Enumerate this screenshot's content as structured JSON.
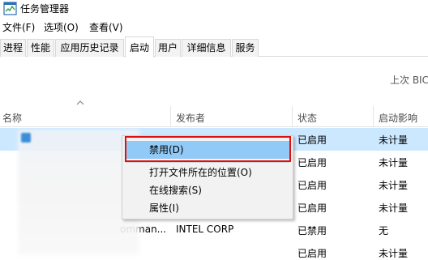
{
  "window": {
    "title": "任务管理器"
  },
  "menu": {
    "file": "文件(F)",
    "options": "选项(O)",
    "view": "查看(V)"
  },
  "tabs": [
    "进程",
    "性能",
    "应用历史记录",
    "启动",
    "用户",
    "详细信息",
    "服务"
  ],
  "active_tab": "启动",
  "top_right_text": "上次 BIC",
  "table": {
    "headers": {
      "name": "名称",
      "publisher": "发布者",
      "status": "状态",
      "impact": "启动影响"
    },
    "rows": [
      {
        "name": "",
        "publisher": "",
        "status": "已启用",
        "impact": "未计量"
      },
      {
        "name": "",
        "publisher": "",
        "status": "已启用",
        "impact": "未计量"
      },
      {
        "name": "",
        "publisher": "",
        "status": "已启用",
        "impact": "未计量"
      },
      {
        "name": "",
        "publisher": "",
        "status": "已启用",
        "impact": "未计量"
      },
      {
        "name": "omman...",
        "publisher": "INTEL CORP",
        "status": "已禁用",
        "impact": "无"
      },
      {
        "name": "",
        "publisher": "",
        "status": "已启用",
        "impact": "未计量"
      }
    ]
  },
  "context_menu": {
    "items": [
      "禁用(D)",
      "打开文件所在的位置(O)",
      "在线搜索(S)",
      "属性(I)"
    ]
  },
  "colors": {
    "selection": "#cce8ff",
    "menu_highlight": "#91c9f7",
    "annotation_red": "#e01010"
  }
}
